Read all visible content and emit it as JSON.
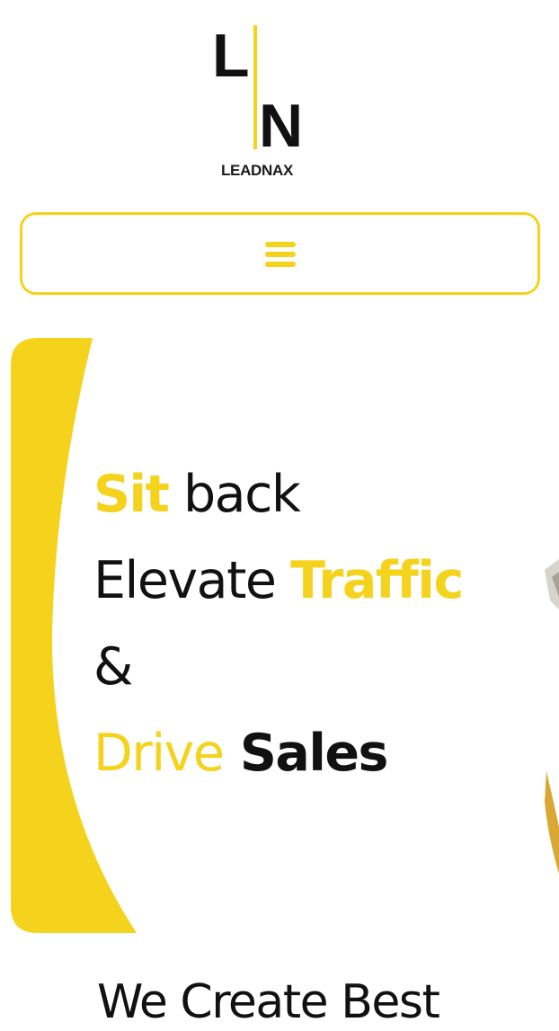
{
  "logo": {
    "letters": [
      "L",
      "N"
    ],
    "brand": "LEADNAX"
  },
  "navigation": {
    "menu_icon": "hamburger-menu-icon"
  },
  "hero": {
    "lines": [
      [
        {
          "text": "Sit",
          "style": "yellow-bold"
        },
        {
          "text": " back",
          "style": "dark"
        }
      ],
      [
        {
          "text": "Elevate ",
          "style": "dark"
        },
        {
          "text": "Traffic",
          "style": "yellow-bold"
        }
      ],
      [
        {
          "text": "&",
          "style": "dark"
        }
      ],
      [
        {
          "text": "Drive",
          "style": "yellow"
        },
        {
          "text": " Sales",
          "style": "dark-bold"
        }
      ]
    ]
  },
  "section": {
    "heading": "We Create Best"
  },
  "colors": {
    "accent": "#f5d21c",
    "text": "#111111",
    "background": "#ffffff"
  }
}
